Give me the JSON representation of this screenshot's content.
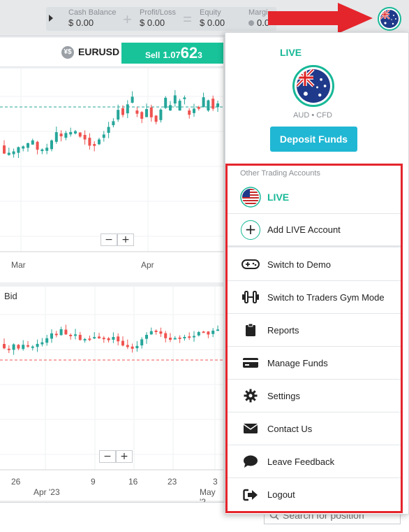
{
  "header": {
    "cash_balance_label": "Cash Balance",
    "cash_balance_value": "$ 0.00",
    "profit_loss_label": "Profit/Loss",
    "profit_loss_value": "$ 0.00",
    "equity_label": "Equity",
    "equity_value": "$ 0.00",
    "margin_label": "Margi",
    "margin_value": "0.0",
    "plus_op": "+",
    "equals_op": "="
  },
  "instrument": {
    "symbol": "EURUSD",
    "sell_word": "Sell",
    "price_prefix": "1.07",
    "price_big": "62",
    "price_suffix": "3"
  },
  "chart_top": {
    "x_labels": [
      "Mar",
      "Apr"
    ],
    "zoom_minus": "−",
    "zoom_plus": "+"
  },
  "chart_bottom": {
    "label": "Bid",
    "x_labels": [
      "26",
      "9",
      "16",
      "23",
      "3"
    ],
    "x_labels_month": [
      "Apr '23",
      "May '2"
    ],
    "zoom_minus": "−",
    "zoom_plus": "+"
  },
  "search": {
    "placeholder": "Search for position"
  },
  "dropdown": {
    "status": "LIVE",
    "account_sub": "AUD • CFD",
    "deposit_label": "Deposit Funds",
    "other_header": "Other Trading Accounts",
    "items": [
      {
        "label": "LIVE",
        "icon": "us-flag-icon"
      },
      {
        "label": "Add LIVE Account",
        "icon": "plus-circle-icon"
      },
      {
        "label": "Switch to Demo",
        "icon": "gamepad-icon"
      },
      {
        "label": "Switch to Traders Gym Mode",
        "icon": "dumbbell-icon"
      },
      {
        "label": "Reports",
        "icon": "clipboard-icon"
      },
      {
        "label": "Manage Funds",
        "icon": "credit-card-icon"
      },
      {
        "label": "Settings",
        "icon": "gear-icon"
      },
      {
        "label": "Contact Us",
        "icon": "envelope-icon"
      },
      {
        "label": "Leave Feedback",
        "icon": "comment-icon"
      },
      {
        "label": "Logout",
        "icon": "logout-icon"
      }
    ]
  },
  "colors": {
    "accent": "#17b897",
    "sell": "#18c39a",
    "deposit": "#20b7d4",
    "highlight": "#e5252c",
    "candle_up": "#26a69a",
    "candle_down": "#ef5350"
  }
}
